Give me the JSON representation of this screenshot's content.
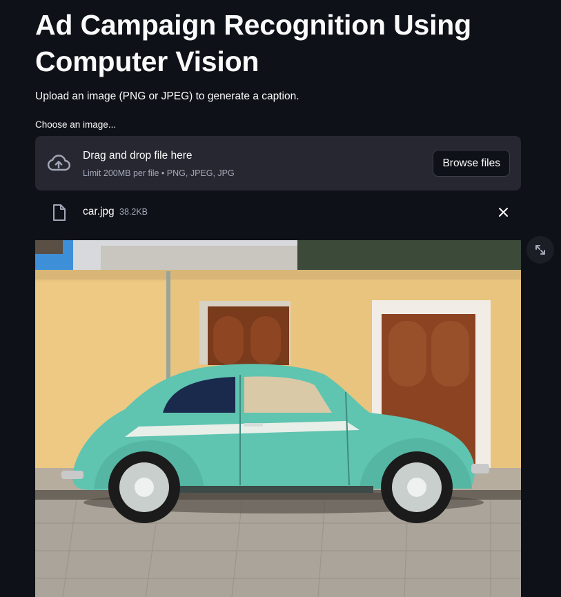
{
  "page": {
    "title": "Ad Campaign Recognition Using Computer Vision",
    "subtitle": "Upload an image (PNG or JPEG) to generate a caption."
  },
  "uploader": {
    "label": "Choose an image...",
    "dropzone_title": "Drag and drop file here",
    "dropzone_limit": "Limit 200MB per file • PNG, JPEG, JPG",
    "browse_label": "Browse files",
    "icon": "cloud-upload-icon"
  },
  "uploaded_file": {
    "name": "car.jpg",
    "size": "38.2KB",
    "icons": {
      "file": "file-icon",
      "remove": "close-icon"
    }
  },
  "image_preview": {
    "fullscreen_icon": "expand-icon"
  },
  "colors": {
    "background": "#0e1117",
    "dropzone": "#262730",
    "text": "#fafafa",
    "muted_text": "#a3a8b8"
  }
}
